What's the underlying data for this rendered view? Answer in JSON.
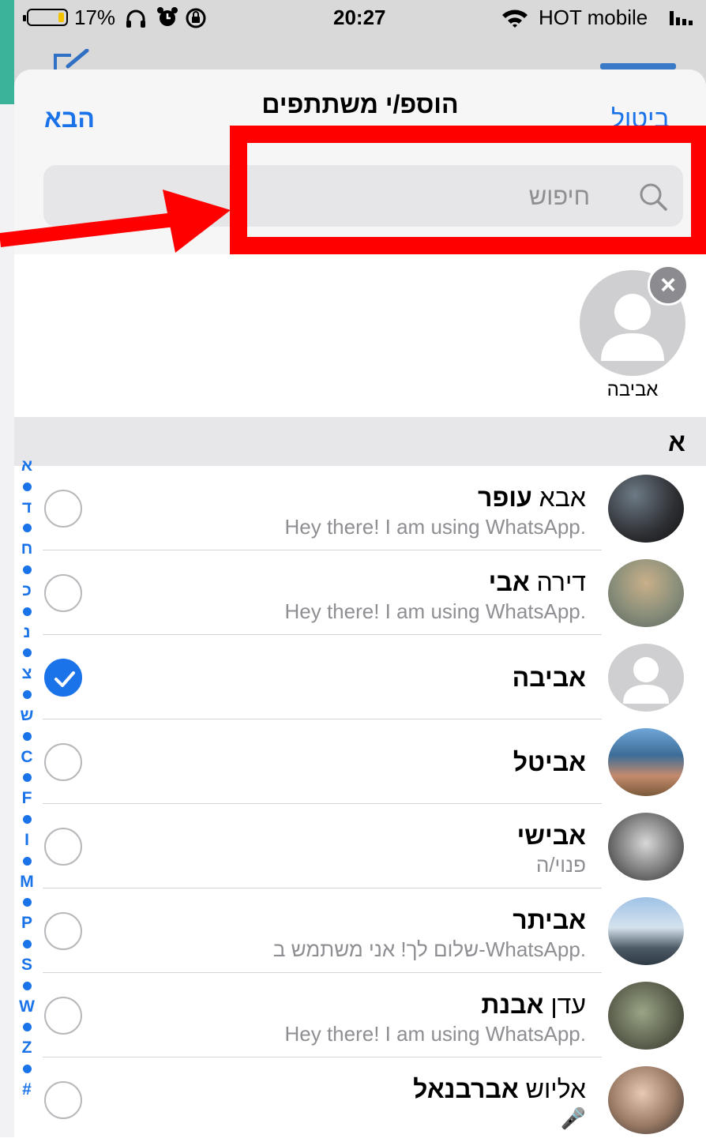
{
  "status_bar": {
    "battery": "17%",
    "time": "20:27",
    "carrier": "HOT mobile"
  },
  "sheet": {
    "title": "הוספ/י משתתפים",
    "next_label": "הבא",
    "cancel_label": "ביטול"
  },
  "search": {
    "placeholder": "חיפוש",
    "value": ""
  },
  "selected": [
    {
      "name": "אביבה"
    }
  ],
  "section": {
    "letter": "א"
  },
  "index_letters": [
    "א",
    "ד",
    "ח",
    "כ",
    "נ",
    "צ",
    "ש",
    "C",
    "F",
    "I",
    "M",
    "P",
    "S",
    "W",
    "Z",
    "#"
  ],
  "contacts": [
    {
      "first": "אבא",
      "last": "עופר",
      "status": "Hey there! I am using WhatsApp.",
      "checked": false
    },
    {
      "first": "דירה",
      "last": "אבי",
      "status": "Hey there! I am using WhatsApp.",
      "checked": false
    },
    {
      "first": "",
      "last": "אביבה",
      "status": "",
      "checked": true
    },
    {
      "first": "",
      "last": "אביטל",
      "status": "",
      "checked": false
    },
    {
      "first": "",
      "last": "אבישי",
      "status": "פנוי/ה",
      "checked": false
    },
    {
      "first": "",
      "last": "אביתר",
      "status": "שלום לך! אני משתמש ב-WhatsApp.",
      "checked": false
    },
    {
      "first": "עדן",
      "last": "אבנת",
      "status": "Hey there! I am using WhatsApp.",
      "checked": false
    },
    {
      "first": "אליוש",
      "last": "אברבנאל",
      "status": "🎤",
      "checked": false
    }
  ],
  "colors": {
    "accent": "#1a73e8",
    "annotation": "#ff0000",
    "secondary_text": "#8e8e93"
  }
}
